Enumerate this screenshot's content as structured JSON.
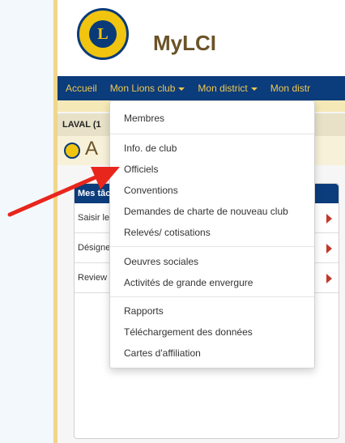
{
  "app": {
    "title": "MyLCI",
    "logo_text": "L"
  },
  "nav": {
    "items": [
      {
        "label": "Accueil"
      },
      {
        "label": "Mon Lions club"
      },
      {
        "label": "Mon district"
      },
      {
        "label": "Mon distr"
      }
    ]
  },
  "club_bar": {
    "text": "LAVAL (1"
  },
  "page": {
    "title_fragment": "A"
  },
  "tasks": {
    "header": "Mes tâc",
    "rows": [
      {
        "label": "Saisir le"
      },
      {
        "label": "Désigne"
      },
      {
        "label": "Review S"
      }
    ]
  },
  "dropdown": {
    "items": [
      {
        "label": "Membres"
      },
      {
        "label": "Info. de club"
      },
      {
        "label": "Officiels"
      },
      {
        "label": "Conventions"
      },
      {
        "label": "Demandes de charte de nouveau club"
      },
      {
        "label": "Relevés/ cotisations"
      },
      {
        "label": "Oeuvres sociales"
      },
      {
        "label": "Activités de grande envergure"
      },
      {
        "label": "Rapports"
      },
      {
        "label": "Téléchargement des données"
      },
      {
        "label": "Cartes d'affiliation"
      }
    ]
  },
  "colors": {
    "nav_bg": "#0b3c7c",
    "nav_text": "#f0c84e",
    "arrow": "#e8261c",
    "brand_gold": "#6b5328"
  }
}
